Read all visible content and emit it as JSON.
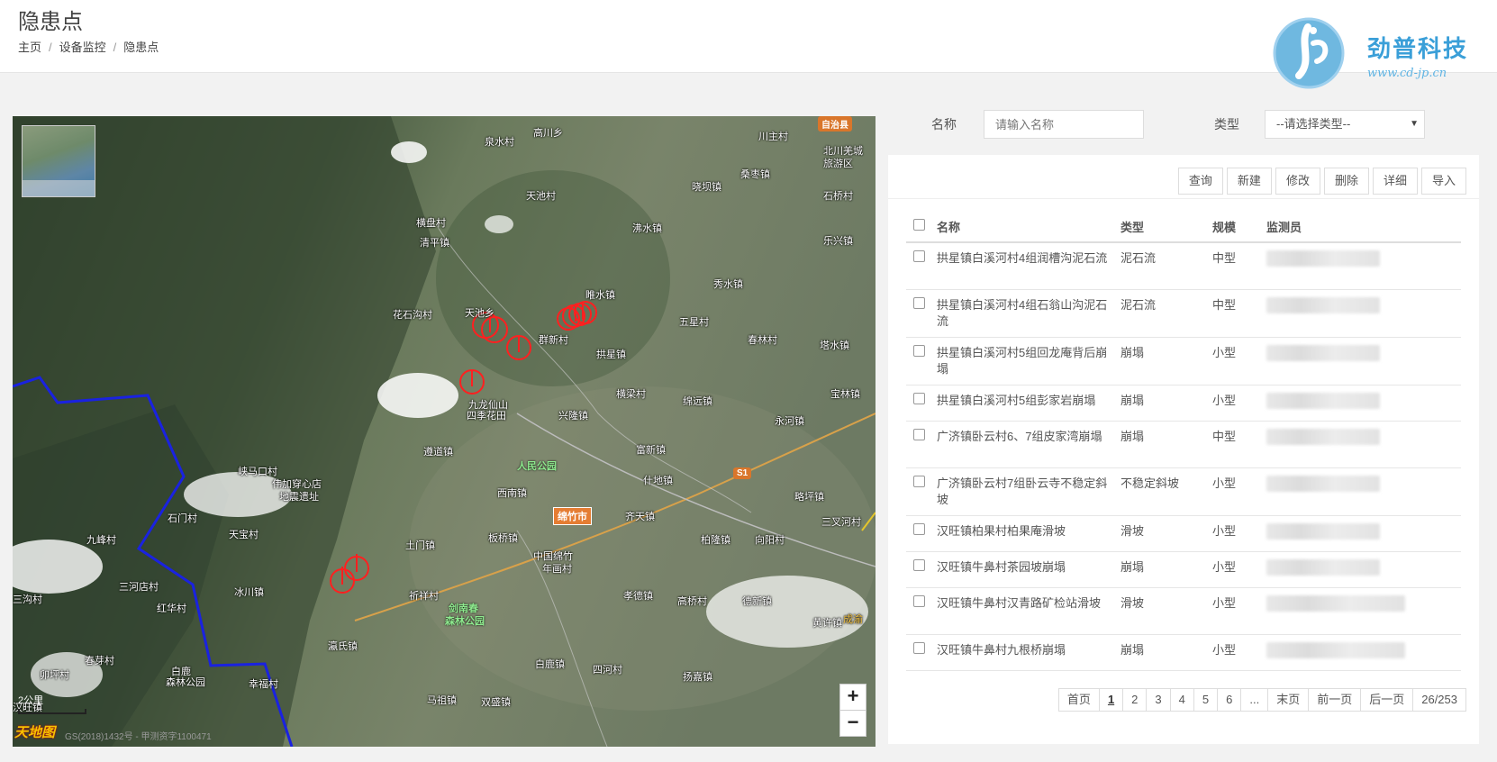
{
  "header": {
    "title": "隐患点",
    "breadcrumb": [
      "主页",
      "设备监控",
      "隐患点"
    ],
    "brand_name": "劲普科技",
    "brand_url": "www.cd-jp.cn"
  },
  "map": {
    "labels": [
      {
        "text": "高川乡"
      },
      {
        "text": "泉水村"
      },
      {
        "text": "川主村"
      },
      {
        "text": "北川羌城"
      },
      {
        "text": "旅游区"
      },
      {
        "text": "晓坝镇"
      },
      {
        "text": "桑枣镇"
      },
      {
        "text": "石桥村"
      },
      {
        "text": "天池村"
      },
      {
        "text": "横盘村"
      },
      {
        "text": "清平镇"
      },
      {
        "text": "沸水镇"
      },
      {
        "text": "乐兴镇"
      },
      {
        "text": "秀水镇"
      },
      {
        "text": "睢水镇"
      },
      {
        "text": "花石沟村"
      },
      {
        "text": "天池乡"
      },
      {
        "text": "五星村"
      },
      {
        "text": "群新村"
      },
      {
        "text": "春林村"
      },
      {
        "text": "塔水镇"
      },
      {
        "text": "拱星镇"
      },
      {
        "text": "横梁村"
      },
      {
        "text": "绵远镇"
      },
      {
        "text": "宝林镇"
      },
      {
        "text": "九龙仙山"
      },
      {
        "text": "四季花田"
      },
      {
        "text": "兴隆镇"
      },
      {
        "text": "永河镇"
      },
      {
        "text": "遵道镇"
      },
      {
        "text": "富新镇"
      },
      {
        "text": "峡马口村"
      },
      {
        "text": "伟加穿心店"
      },
      {
        "text": "地震遗址"
      },
      {
        "text": "西南镇"
      },
      {
        "text": "什地镇"
      },
      {
        "text": "略坪镇"
      },
      {
        "text": "石门村"
      },
      {
        "text": "天宝村"
      },
      {
        "text": "齐天镇"
      },
      {
        "text": "九峰村"
      },
      {
        "text": "土门镇"
      },
      {
        "text": "板桥镇"
      },
      {
        "text": "柏隆镇"
      },
      {
        "text": "向阳村"
      },
      {
        "text": "三叉河村"
      },
      {
        "text": "中国绵竹"
      },
      {
        "text": "年画村"
      },
      {
        "text": "三河店村"
      },
      {
        "text": "红华村"
      },
      {
        "text": "冰川镇"
      },
      {
        "text": "祈祥村"
      },
      {
        "text": "孝德镇"
      },
      {
        "text": "高桥村"
      },
      {
        "text": "德新镇"
      },
      {
        "text": "三沟村"
      },
      {
        "text": "黄许镇"
      },
      {
        "text": "汉旺镇"
      },
      {
        "text": "瀛氏镇"
      },
      {
        "text": "春芽村"
      },
      {
        "text": "白鹿镇"
      },
      {
        "text": "四河村"
      },
      {
        "text": "扬嘉镇"
      },
      {
        "text": "白鹿"
      },
      {
        "text": "森林公园"
      },
      {
        "text": "幸福村"
      },
      {
        "text": "马祖镇"
      },
      {
        "text": "双盛镇"
      },
      {
        "text": "卯坪村"
      },
      {
        "text": "成渝"
      }
    ],
    "badges": {
      "autonomous": "自治县",
      "city": "绵竹市",
      "road": "S1"
    },
    "parks": {
      "people_park": "人民公园",
      "forest_park_1": "剑南春",
      "forest_park_2": "森林公园"
    },
    "zoom_in": "+",
    "zoom_out": "−",
    "scale": "2公里",
    "logo": "天地图",
    "copyright": "GS(2018)1432号 - 甲测资字1100471"
  },
  "search": {
    "name_label": "名称",
    "name_placeholder": "请输入名称",
    "type_label": "类型",
    "type_selected": "--请选择类型--"
  },
  "toolbar": {
    "query": "查询",
    "create": "新建",
    "edit": "修改",
    "delete": "删除",
    "detail": "详细",
    "import": "导入"
  },
  "table": {
    "headers": {
      "name": "名称",
      "type": "类型",
      "scale": "规模",
      "monitor": "监测员"
    },
    "rows": [
      {
        "name": "拱星镇白溪河村4组润槽沟泥石流",
        "type": "泥石流",
        "scale": "中型"
      },
      {
        "name": "拱星镇白溪河村4组石翁山沟泥石流",
        "type": "泥石流",
        "scale": "中型"
      },
      {
        "name": "拱星镇白溪河村5组回龙庵背后崩塌",
        "type": "崩塌",
        "scale": "小型"
      },
      {
        "name": "拱星镇白溪河村5组彭家岩崩塌",
        "type": "崩塌",
        "scale": "小型"
      },
      {
        "name": "广济镇卧云村6、7组皮家湾崩塌",
        "type": "崩塌",
        "scale": "中型"
      },
      {
        "name": "广济镇卧云村7组卧云寺不稳定斜坡",
        "type": "不稳定斜坡",
        "scale": "小型"
      },
      {
        "name": "汉旺镇柏果村柏果庵滑坡",
        "type": "滑坡",
        "scale": "小型"
      },
      {
        "name": "汉旺镇牛鼻村茶园坡崩塌",
        "type": "崩塌",
        "scale": "小型"
      },
      {
        "name": "汉旺镇牛鼻村汉青路矿检站滑坡",
        "type": "滑坡",
        "scale": "小型"
      },
      {
        "name": "汉旺镇牛鼻村九根桥崩塌",
        "type": "崩塌",
        "scale": "小型"
      }
    ]
  },
  "pager": {
    "first": "首页",
    "pages": [
      "1",
      "2",
      "3",
      "4",
      "5",
      "6",
      "..."
    ],
    "last": "末页",
    "prev": "前一页",
    "next": "后一页",
    "info": "26/253"
  }
}
